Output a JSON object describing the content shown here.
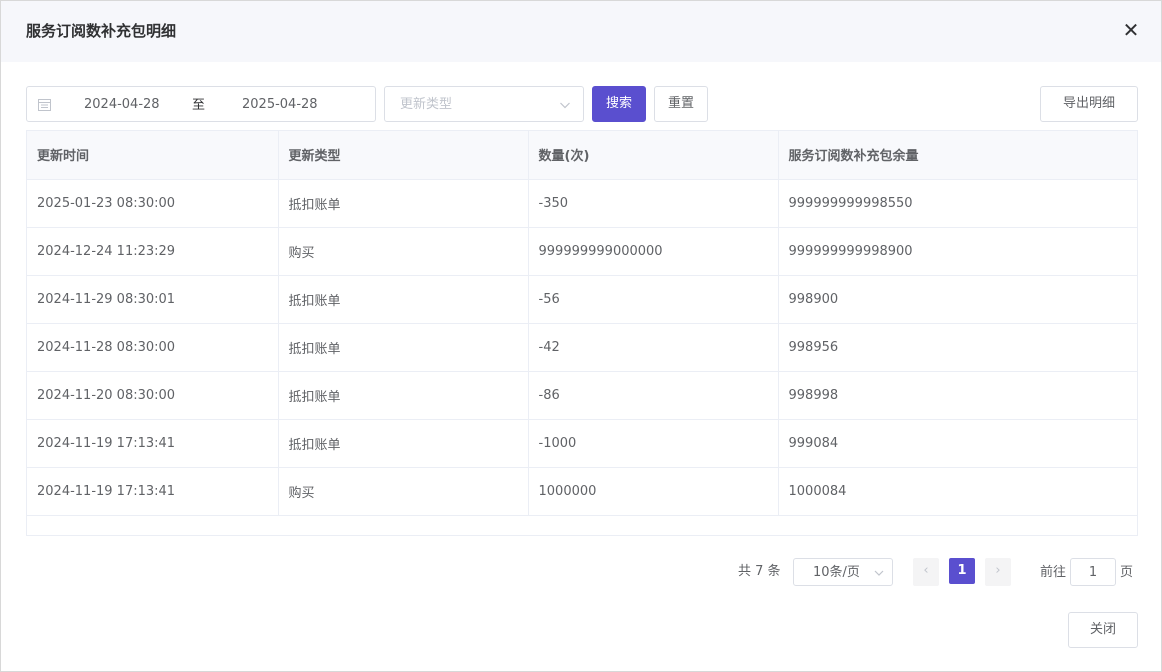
{
  "dialog": {
    "title": "服务订阅数补充包明细",
    "close_icon": "✕"
  },
  "filters": {
    "date_start": "2024-04-28",
    "date_separator": "至",
    "date_end": "2025-04-28",
    "type_placeholder": "更新类型",
    "search_label": "搜索",
    "reset_label": "重置",
    "export_label": "导出明细"
  },
  "table": {
    "headers": [
      "更新时间",
      "更新类型",
      "数量(次)",
      "服务订阅数补充包余量"
    ],
    "rows": [
      [
        "2025-01-23 08:30:00",
        "抵扣账单",
        "-350",
        "999999999998550"
      ],
      [
        "2024-12-24 11:23:29",
        "购买",
        "999999999000000",
        "999999999998900"
      ],
      [
        "2024-11-29 08:30:01",
        "抵扣账单",
        "-56",
        "998900"
      ],
      [
        "2024-11-28 08:30:00",
        "抵扣账单",
        "-42",
        "998956"
      ],
      [
        "2024-11-20 08:30:00",
        "抵扣账单",
        "-86",
        "998998"
      ],
      [
        "2024-11-19 17:13:41",
        "抵扣账单",
        "-1000",
        "999084"
      ],
      [
        "2024-11-19 17:13:41",
        "购买",
        "1000000",
        "1000084"
      ]
    ]
  },
  "pagination": {
    "total_text": "共 7 条",
    "page_size": "10条/页",
    "prev_icon": "‹",
    "current_page": "1",
    "next_icon": "›",
    "goto_label": "前往",
    "goto_value": "1",
    "goto_suffix": "页"
  },
  "footer": {
    "close_label": "关闭"
  },
  "colors": {
    "primary": "#5a4fcf",
    "header_bg": "#f6f7fb",
    "border": "#dcdfe6"
  }
}
